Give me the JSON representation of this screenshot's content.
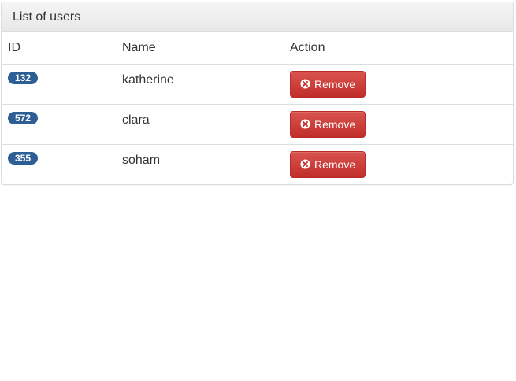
{
  "panel": {
    "title": "List of users"
  },
  "table": {
    "headers": {
      "id": "ID",
      "name": "Name",
      "action": "Action"
    },
    "rows": [
      {
        "id": "132",
        "name": "katherine",
        "action_label": "Remove"
      },
      {
        "id": "572",
        "name": "clara",
        "action_label": "Remove"
      },
      {
        "id": "355",
        "name": "soham",
        "action_label": "Remove"
      }
    ]
  },
  "colors": {
    "badge": "#2d5f96",
    "danger": "#d9534f"
  },
  "icons": {
    "remove": "remove-circle-icon"
  }
}
